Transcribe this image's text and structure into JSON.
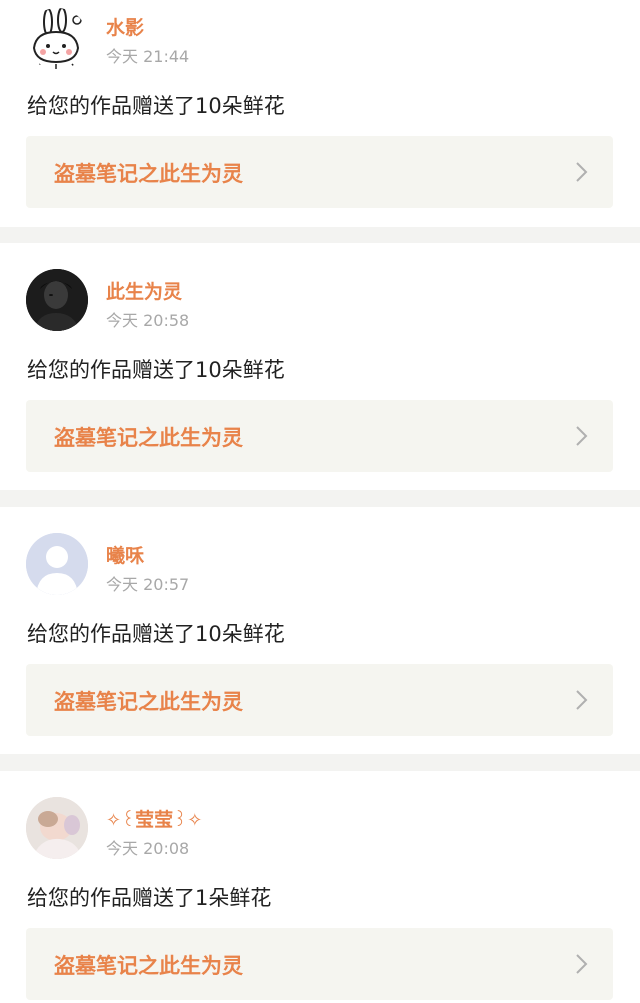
{
  "notifications": [
    {
      "username": "水影",
      "avatar": "cartoon-rabbit-avatar",
      "time": "今天 21:44",
      "message": "给您的作品赠送了10朵鲜花",
      "work_title": "盗墓笔记之此生为灵"
    },
    {
      "username": "此生为灵",
      "avatar": "dark-portrait-avatar",
      "time": "今天 20:58",
      "message": "给您的作品赠送了10朵鲜花",
      "work_title": "盗墓笔记之此生为灵"
    },
    {
      "username": "曦咊",
      "avatar": "default-user-avatar",
      "time": "今天 20:57",
      "message": "给您的作品赠送了10朵鲜花",
      "work_title": "盗墓笔记之此生为灵"
    },
    {
      "username": "莹莹",
      "avatar": "photo-avatar",
      "time": "今天 20:08",
      "message": "给您的作品赠送了1朵鲜花",
      "work_title": "盗墓笔记之此生为灵"
    }
  ],
  "colors": {
    "accent": "#e8834a",
    "time": "#a8a8a8",
    "text": "#222222",
    "card_link_bg": "#f5f5f0",
    "divider": "#f3f3f1"
  },
  "icons": {
    "chevron": "chevron-right-icon"
  }
}
